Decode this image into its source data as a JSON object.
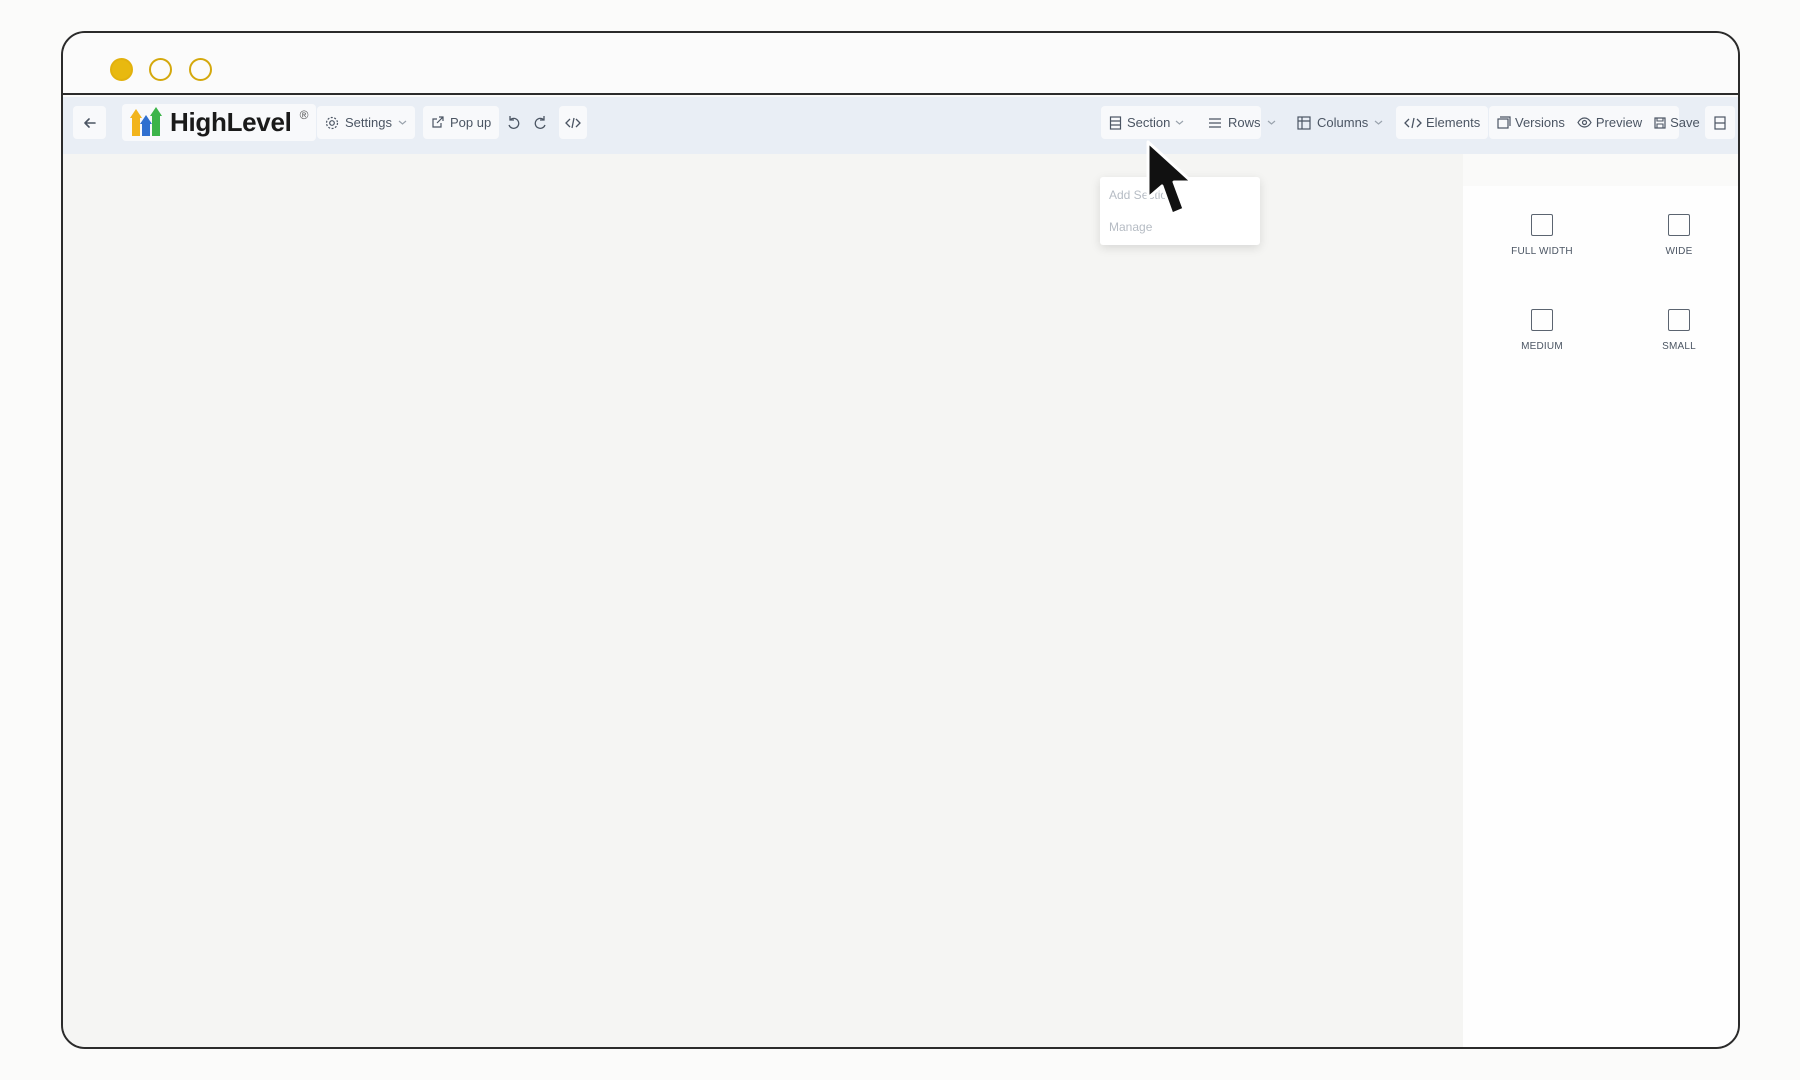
{
  "window": {
    "traffic_lights": [
      "close-dot",
      "minimize-dot",
      "maximize-dot"
    ]
  },
  "toolbar": {
    "back_icon": "arrow-left-icon",
    "logo_text": "HighLevel",
    "logo_mark": "®",
    "settings_label": "Settings",
    "popup_label": "Pop up",
    "section_label": "Section",
    "rows_label": "Rows",
    "columns_label": "Columns",
    "elements_label": "Elements",
    "versions_label": "Versions",
    "preview_label": "Preview",
    "save_label": "Save"
  },
  "section_menu": {
    "items": [
      "Add Section",
      "Manage"
    ]
  },
  "right_panel": {
    "options": [
      "FULL WIDTH",
      "WIDE",
      "MEDIUM",
      "SMALL"
    ]
  },
  "colors": {
    "toolbar_bg": "#e9eef5",
    "accent_dot": "#e8b90f",
    "window_border": "#2b2b2b"
  }
}
